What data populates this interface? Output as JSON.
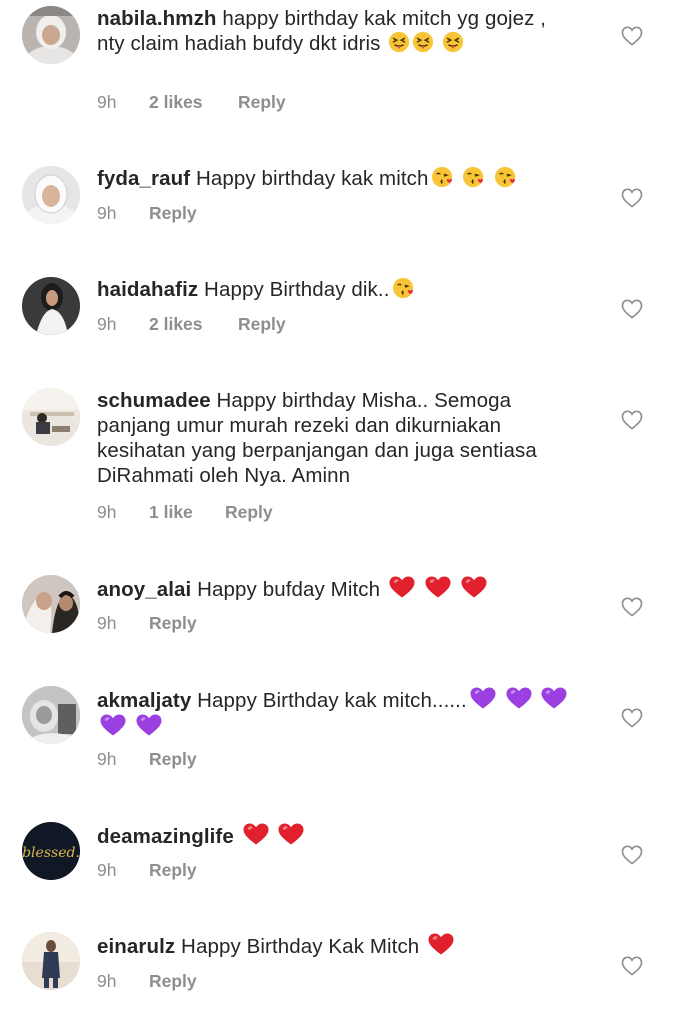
{
  "comments": [
    {
      "username": "nabila.hmzh",
      "text": " happy birthday kak mitch yg gojez , nty claim hadiah bufdy dkt idris ",
      "emoji": [
        "squint-tongue",
        "squint-tongue",
        "squint-tongue"
      ],
      "time": "9h",
      "likes": "2 likes",
      "reply": "Reply",
      "avatar": "avatar-hijab"
    },
    {
      "username": "fyda_rauf",
      "text": " Happy birthday kak mitch",
      "emoji": [
        "kiss-heart",
        "kiss-heart",
        "kiss-heart"
      ],
      "time": "9h",
      "likes": "",
      "reply": "Reply",
      "avatar": "avatar-hijab-light"
    },
    {
      "username": "haidahafiz",
      "text": " Happy Birthday dik..",
      "emoji": [
        "kiss-heart"
      ],
      "time": "9h",
      "likes": "2 likes",
      "reply": "Reply",
      "avatar": "avatar-dark-hair"
    },
    {
      "username": "schumadee",
      "text": " Happy birthday Misha.. Semoga panjang umur murah rezeki dan dikurniakan kesihatan yang berpanjangan dan juga sentiasa DiRahmati oleh Nya. Aminn",
      "emoji": [],
      "time": "9h",
      "likes": "1 like",
      "reply": "Reply",
      "avatar": "avatar-room"
    },
    {
      "username": "anoy_alai",
      "text": " Happy bufday Mitch ",
      "emoji": [
        "red-heart",
        "red-heart",
        "red-heart"
      ],
      "time": "9h",
      "likes": "",
      "reply": "Reply",
      "avatar": "avatar-couple"
    },
    {
      "username": "akmaljaty",
      "text": " Happy Birthday kak mitch......",
      "emoji": [
        "purple-heart",
        "purple-heart",
        "purple-heart",
        "purple-heart",
        "purple-heart"
      ],
      "time": "9h",
      "likes": "",
      "reply": "Reply",
      "avatar": "avatar-bw"
    },
    {
      "username": "deamazinglife",
      "text": " ",
      "emoji": [
        "red-heart",
        "red-heart"
      ],
      "time": "9h",
      "likes": "",
      "reply": "Reply",
      "avatar": "avatar-blessed",
      "avatar_text": "blessed."
    },
    {
      "username": "einarulz",
      "text": " Happy Birthday Kak Mitch ",
      "emoji": [
        "red-heart"
      ],
      "time": "9h",
      "likes": "",
      "reply": "Reply",
      "avatar": "avatar-standing"
    }
  ],
  "colors": {
    "text": "#262626",
    "meta": "#8e8e8e",
    "heart_outline": "#8e8e8e"
  }
}
